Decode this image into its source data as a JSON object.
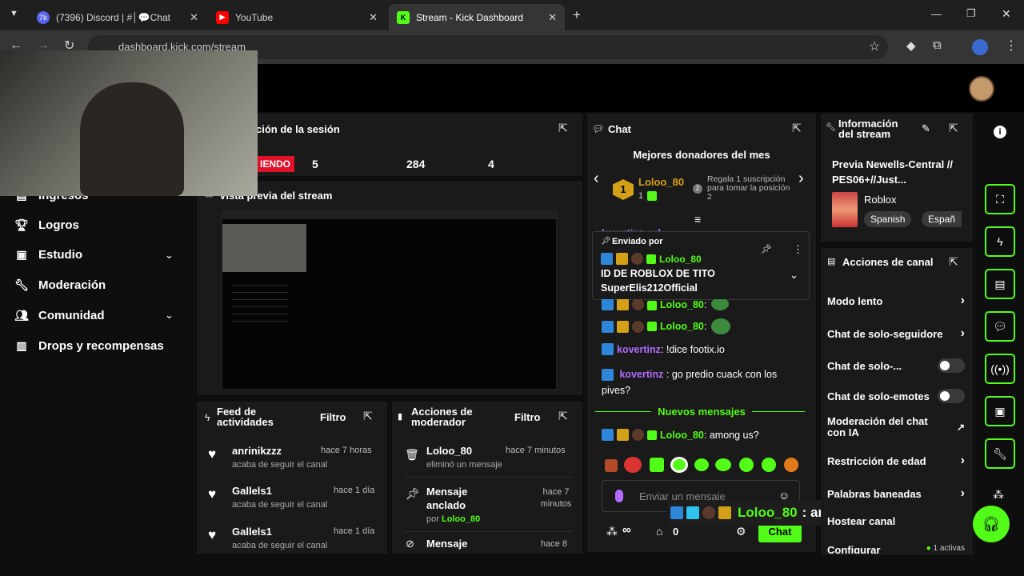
{
  "browser": {
    "tabs": [
      {
        "label": "(7396) Discord | #│💬Chat",
        "icon": "discord-icon"
      },
      {
        "label": "YouTube",
        "icon": "youtube-icon"
      },
      {
        "label": "Stream - Kick Dashboard",
        "icon": "kick-icon"
      }
    ],
    "url": "dashboard.kick.com/stream"
  },
  "sidebar": {
    "items": [
      {
        "label": "Ingresos",
        "icon": "income-icon"
      },
      {
        "label": "Logros",
        "icon": "trophy-icon"
      },
      {
        "label": "Estudio",
        "icon": "studio-icon"
      },
      {
        "label": "Moderación",
        "icon": "wrench-icon"
      },
      {
        "label": "Comunidad",
        "icon": "community-icon"
      },
      {
        "label": "Drops y recompensas",
        "icon": "drops-icon"
      }
    ]
  },
  "session": {
    "title": "ción de la sesión",
    "live_badge": "IENDO",
    "stats": [
      "5",
      "284",
      "4"
    ]
  },
  "preview": {
    "title": "Vista previa del stream"
  },
  "feed": {
    "title": "Feed de actividades",
    "filter": "Filtro",
    "items": [
      {
        "user": "anrinikzzz",
        "time": "hace 7 horas",
        "action": "acaba de seguir el canal"
      },
      {
        "user": "Gallels1",
        "time": "hace 1 día",
        "action": "acaba de seguir el canal"
      },
      {
        "user": "Gallels1",
        "time": "hace 1 día",
        "action": "acaba de seguir el canal"
      }
    ]
  },
  "modactions": {
    "title": "Acciones de moderador",
    "filter": "Filtro",
    "items": [
      {
        "user": "Loloo_80",
        "time": "hace 7 minutos",
        "action": "eliminó un mensaje"
      },
      {
        "user": "Mensaje anclado",
        "time": "hace 7 minutos",
        "action_prefix": "por",
        "by": "Loloo_80"
      },
      {
        "user": "Mensaje",
        "time": "hace 8"
      }
    ]
  },
  "chat": {
    "title": "Chat",
    "donors_title": "Mejores donadores del mes",
    "top_donor": {
      "rank": "1",
      "name": "Loloo_80",
      "count": "1"
    },
    "gift_hint": "Regala 1 suscripción para tomar la posición 2",
    "gift_hint_count": "2",
    "pinned": {
      "label": "Enviado por",
      "user": "Loloo_80",
      "line1": "ID DE ROBLOX DE TITO",
      "line2": "SuperElis212Official"
    },
    "partial_top": "kovertinz: xd",
    "messages": [
      {
        "user": "Loloo_80",
        "text": ":"
      },
      {
        "user": "Loloo_80",
        "text": ":"
      },
      {
        "user": "kovertinz",
        "text": "!dice footix.io"
      },
      {
        "user": "kovertinz",
        "text": "go predio cuack con los",
        "text2": "pives?"
      }
    ],
    "new_messages": "Nuevos mensajes",
    "last_msg": {
      "user": "Loloo_80",
      "text": "among us?"
    },
    "input_placeholder": "Enviar un mensaje",
    "infinity": "∞",
    "zero": "0",
    "send": "Chat"
  },
  "overlay_msg": {
    "user": "Loloo_80",
    "text": ": among us?"
  },
  "info": {
    "title": "Información del stream",
    "stream_title": "Previa Newells-Central // PES06+//Just...",
    "category": "Roblox",
    "tags": [
      "Spanish",
      "Españ"
    ]
  },
  "channel_actions": {
    "title": "Acciones de canal",
    "rows": [
      {
        "label": "Modo lento",
        "ctrl": "chevron"
      },
      {
        "label": "Chat de solo-seguidore",
        "ctrl": "chevron"
      },
      {
        "label": "Chat de solo-...",
        "ctrl": "toggle"
      },
      {
        "label": "Chat de solo-emotes",
        "ctrl": "toggle"
      },
      {
        "label": "Moderación del chat con IA",
        "ctrl": "external"
      },
      {
        "label": "Restricción de edad",
        "ctrl": "chevron"
      },
      {
        "label": "Palabras baneadas",
        "ctrl": "chevron"
      },
      {
        "label": "Hostear canal",
        "ctrl": "none"
      },
      {
        "label": "Configurar",
        "ctrl": "chevron",
        "status": "1 activas"
      }
    ]
  },
  "colors": {
    "kick_green": "#53fc18",
    "live_red": "#e1112a",
    "mod_blue": "#2e86d9",
    "sub_gold": "#d4a017",
    "purple_user": "#b36cff"
  }
}
